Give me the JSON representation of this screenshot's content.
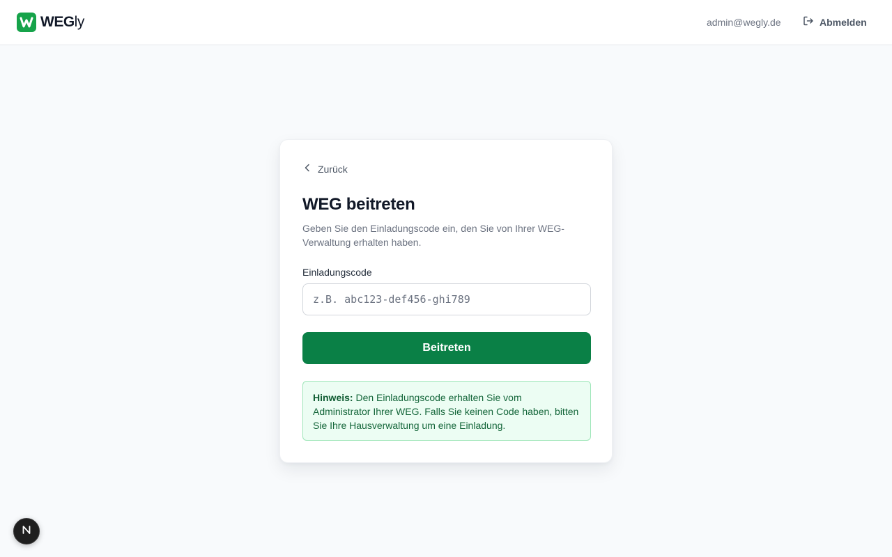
{
  "header": {
    "logo": {
      "bold": "WEG",
      "light": "ly",
      "icon": "w-logo-icon",
      "color": "#16a34a"
    },
    "user_email": "admin@wegly.de",
    "logout_label": "Abmelden",
    "logout_icon": "logout-icon"
  },
  "card": {
    "back_label": "Zurück",
    "back_icon": "chevron-left-icon",
    "title": "WEG beitreten",
    "description": "Geben Sie den Einladungscode ein, den Sie von Ihrer WEG-Verwaltung erhalten haben.",
    "input_label": "Einladungscode",
    "input_placeholder": "z.B. abc123-def456-ghi789",
    "input_value": "",
    "submit_label": "Beitreten",
    "hint_title": "Hinweis:",
    "hint_text": " Den Einladungscode erhalten Sie vom Administrator Ihrer WEG. Falls Sie keinen Code haben, bitten Sie Ihre Hausverwaltung um eine Einladung."
  },
  "colors": {
    "primary": "#0a8046",
    "hint_bg": "#ecfdf3",
    "hint_border": "#9ee6b8",
    "page_bg": "#f8fafc"
  },
  "dev_badge": {
    "icon": "n-logo-icon",
    "label": "N"
  }
}
